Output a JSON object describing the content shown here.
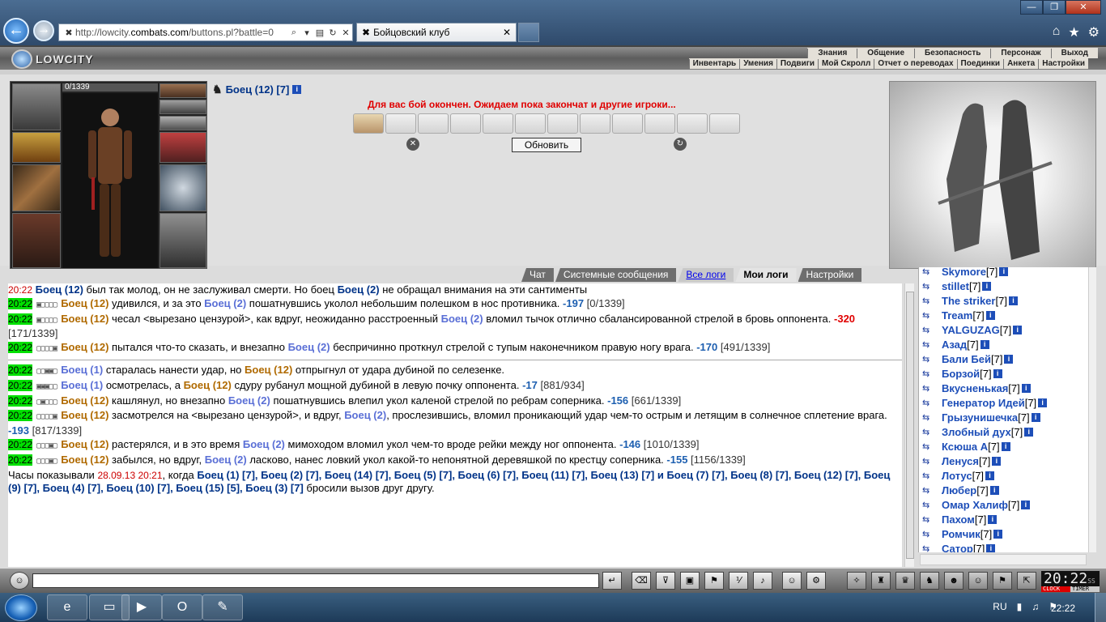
{
  "browser": {
    "url_prefix": "http://lowcity.",
    "url_domain": "combats.com",
    "url_suffix": "/buttons.pl?battle=0",
    "tab_title": "Бойцовский клуб"
  },
  "logo": "LOWCITY",
  "menu_top": [
    "Знания",
    "Общение",
    "Безопасность",
    "Персонаж",
    "Выход"
  ],
  "menu_sub": [
    "Инвентарь",
    "Умения",
    "Подвиги",
    "Мой Скролл",
    "Отчет о переводах",
    "Поединки",
    "Анкета",
    "Настройки"
  ],
  "character": {
    "hp": "0/1339"
  },
  "fighter_name": "Боец (12) [7]",
  "battle_message": "Для вас бой окончен. Ожидаем пока закончат и другие игроки...",
  "refresh_label": "Обновить",
  "tabs": [
    "Чат",
    "Системные сообщения",
    "Все логи",
    "Мои логи",
    "Настройки"
  ],
  "log": {
    "first_time": "20:22",
    "first_a": "Боец (12)",
    "first_b": " был так молод, он не заслуживал смерти. Но боец ",
    "first_c": "Боец (2)",
    "first_d": " не обращал внимания на эти сантименты",
    "entries": [
      {
        "time": "20:22",
        "boxes": "▣▢▢▢▢",
        "who": "Боец (12)",
        "text": " удивился, и за это ",
        "who2": "Боец (2)",
        "text2": " пошатнувшись уколол небольшим полешком в нос противника. ",
        "dmg": "-197",
        "hp": " [0/1339]",
        "crit": false
      },
      {
        "time": "20:22",
        "boxes": "▣▢▢▢▢",
        "who": "Боец (12)",
        "text": " чесал <вырезано цензурой>, как вдруг, неожиданно расстроенный ",
        "who2": "Боец (2)",
        "text2": " вломил тычок отлично сбалансированной стрелой в бровь оппонента. ",
        "dmg": "-320",
        "hp": " [171/1339]",
        "crit": true
      },
      {
        "time": "20:22",
        "boxes": "▢▢▢▢▣",
        "who": "Боец (12)",
        "text": " пытался что-то сказать, и внезапно ",
        "who2": "Боец (2)",
        "text2": " беспричинно проткнул стрелой с тупым наконечником правую ногу врага. ",
        "dmg": "-170",
        "hp": " [491/1339]",
        "crit": false
      }
    ],
    "entries2": [
      {
        "time": "20:22",
        "boxes": "▢▢▣▣▢",
        "who": "Боец (1)",
        "text": " старалась нанести удар, но ",
        "who2": "Боец (12)",
        "text2": " отпрыгнул от удара дубиной по селезенке.",
        "dmg": "",
        "hp": "",
        "crit": false,
        "w2": "b12",
        "w1": "b2"
      },
      {
        "time": "20:22",
        "boxes": "▣▣▣▢▢",
        "who": "Боец (1)",
        "text": " осмотрелась, а ",
        "who2": "Боец (12)",
        "text2": " сдуру рубанул мощной дубиной в левую почку оппонента. ",
        "dmg": "-17",
        "hp": " [881/934]",
        "crit": false,
        "w2": "b12",
        "w1": "b2"
      },
      {
        "time": "20:22",
        "boxes": "▢▣▢▢▢",
        "who": "Боец (12)",
        "text": " кашлянул, но внезапно ",
        "who2": "Боец (2)",
        "text2": " пошатнувшись влепил укол каленой стрелой по ребрам соперника. ",
        "dmg": "-156",
        "hp": " [661/1339]",
        "crit": false,
        "w2": "b2",
        "w1": "b12"
      },
      {
        "time": "20:22",
        "boxes": "▢▢▢▢▣",
        "who": "Боец (12)",
        "text": " засмотрелся на <вырезано цензурой>, и вдруг, ",
        "who2": "Боец (2)",
        "text2": ", прослезившись, вломил проникающий удар чем-то острым и летящим в солнечное сплетение врага. ",
        "dmg": "-193",
        "hp": " [817/1339]",
        "crit": false,
        "w2": "b2",
        "w1": "b12"
      },
      {
        "time": "20:22",
        "boxes": "▢▢▢▣▢",
        "who": "Боец (12)",
        "text": " растерялся, и в это время ",
        "who2": "Боец (2)",
        "text2": " мимоходом вломил укол чем-то вроде рейки между ног оппонента. ",
        "dmg": "-146",
        "hp": " [1010/1339]",
        "crit": false,
        "w2": "b2",
        "w1": "b12"
      },
      {
        "time": "20:22",
        "boxes": "▢▢▢▣▢",
        "who": "Боец (12)",
        "text": " забылся, но вдруг, ",
        "who2": "Боец (2)",
        "text2": " ласково, нанес ловкий укол какой-то непонятной деревяшкой по крестцу соперника. ",
        "dmg": "-155",
        "hp": " [1156/1339]",
        "crit": false,
        "w2": "b2",
        "w1": "b12"
      }
    ],
    "final_prefix": "Часы показывали ",
    "final_time": "28.09.13 20:21",
    "final_mid": ", когда ",
    "final_fighters": "Боец (1) [7], Боец (2) [7], Боец (14) [7], Боец (5) [7], Боец (6) [7], Боец (11) [7], Боец (13) [7] и Боец (7) [7], Боец (8) [7], Боец (12) [7], Боец (9) [7], Боец (4) [7], Боец (10) [7], Боец (15) [5], Боец (3) [7]",
    "final_suffix": " бросили вызов друг другу."
  },
  "online": [
    {
      "name": "Skymore",
      "lvl": "[7]"
    },
    {
      "name": "stillet",
      "lvl": "[7]"
    },
    {
      "name": "The striker",
      "lvl": "[7]"
    },
    {
      "name": "Tream",
      "lvl": "[7]"
    },
    {
      "name": "YALGUZAG",
      "lvl": "[7]"
    },
    {
      "name": "Азад",
      "lvl": "[7]"
    },
    {
      "name": "Бали Бей",
      "lvl": "[7]"
    },
    {
      "name": "Борзой",
      "lvl": "[7]"
    },
    {
      "name": "Вкусненькая",
      "lvl": "[7]"
    },
    {
      "name": "Генератор Идей",
      "lvl": "[7]"
    },
    {
      "name": "Грызунишечка",
      "lvl": "[7]"
    },
    {
      "name": "Злобный дух",
      "lvl": "[7]"
    },
    {
      "name": "Ксюша А",
      "lvl": "[7]"
    },
    {
      "name": "Ленуся",
      "lvl": "[7]"
    },
    {
      "name": "Лотус",
      "lvl": "[7]"
    },
    {
      "name": "Любер",
      "lvl": "[7]"
    },
    {
      "name": "Омар Халиф",
      "lvl": "[7]"
    },
    {
      "name": "Пахом",
      "lvl": "[7]"
    },
    {
      "name": "Ромчик",
      "lvl": "[7]"
    },
    {
      "name": "Сатор",
      "lvl": "[7]"
    }
  ],
  "clock": {
    "time": "20:22",
    "ss": "SS",
    "label1": "CLOCK",
    "label2": "TIMER"
  },
  "taskbar": {
    "lang": "RU",
    "time": "22:22"
  }
}
